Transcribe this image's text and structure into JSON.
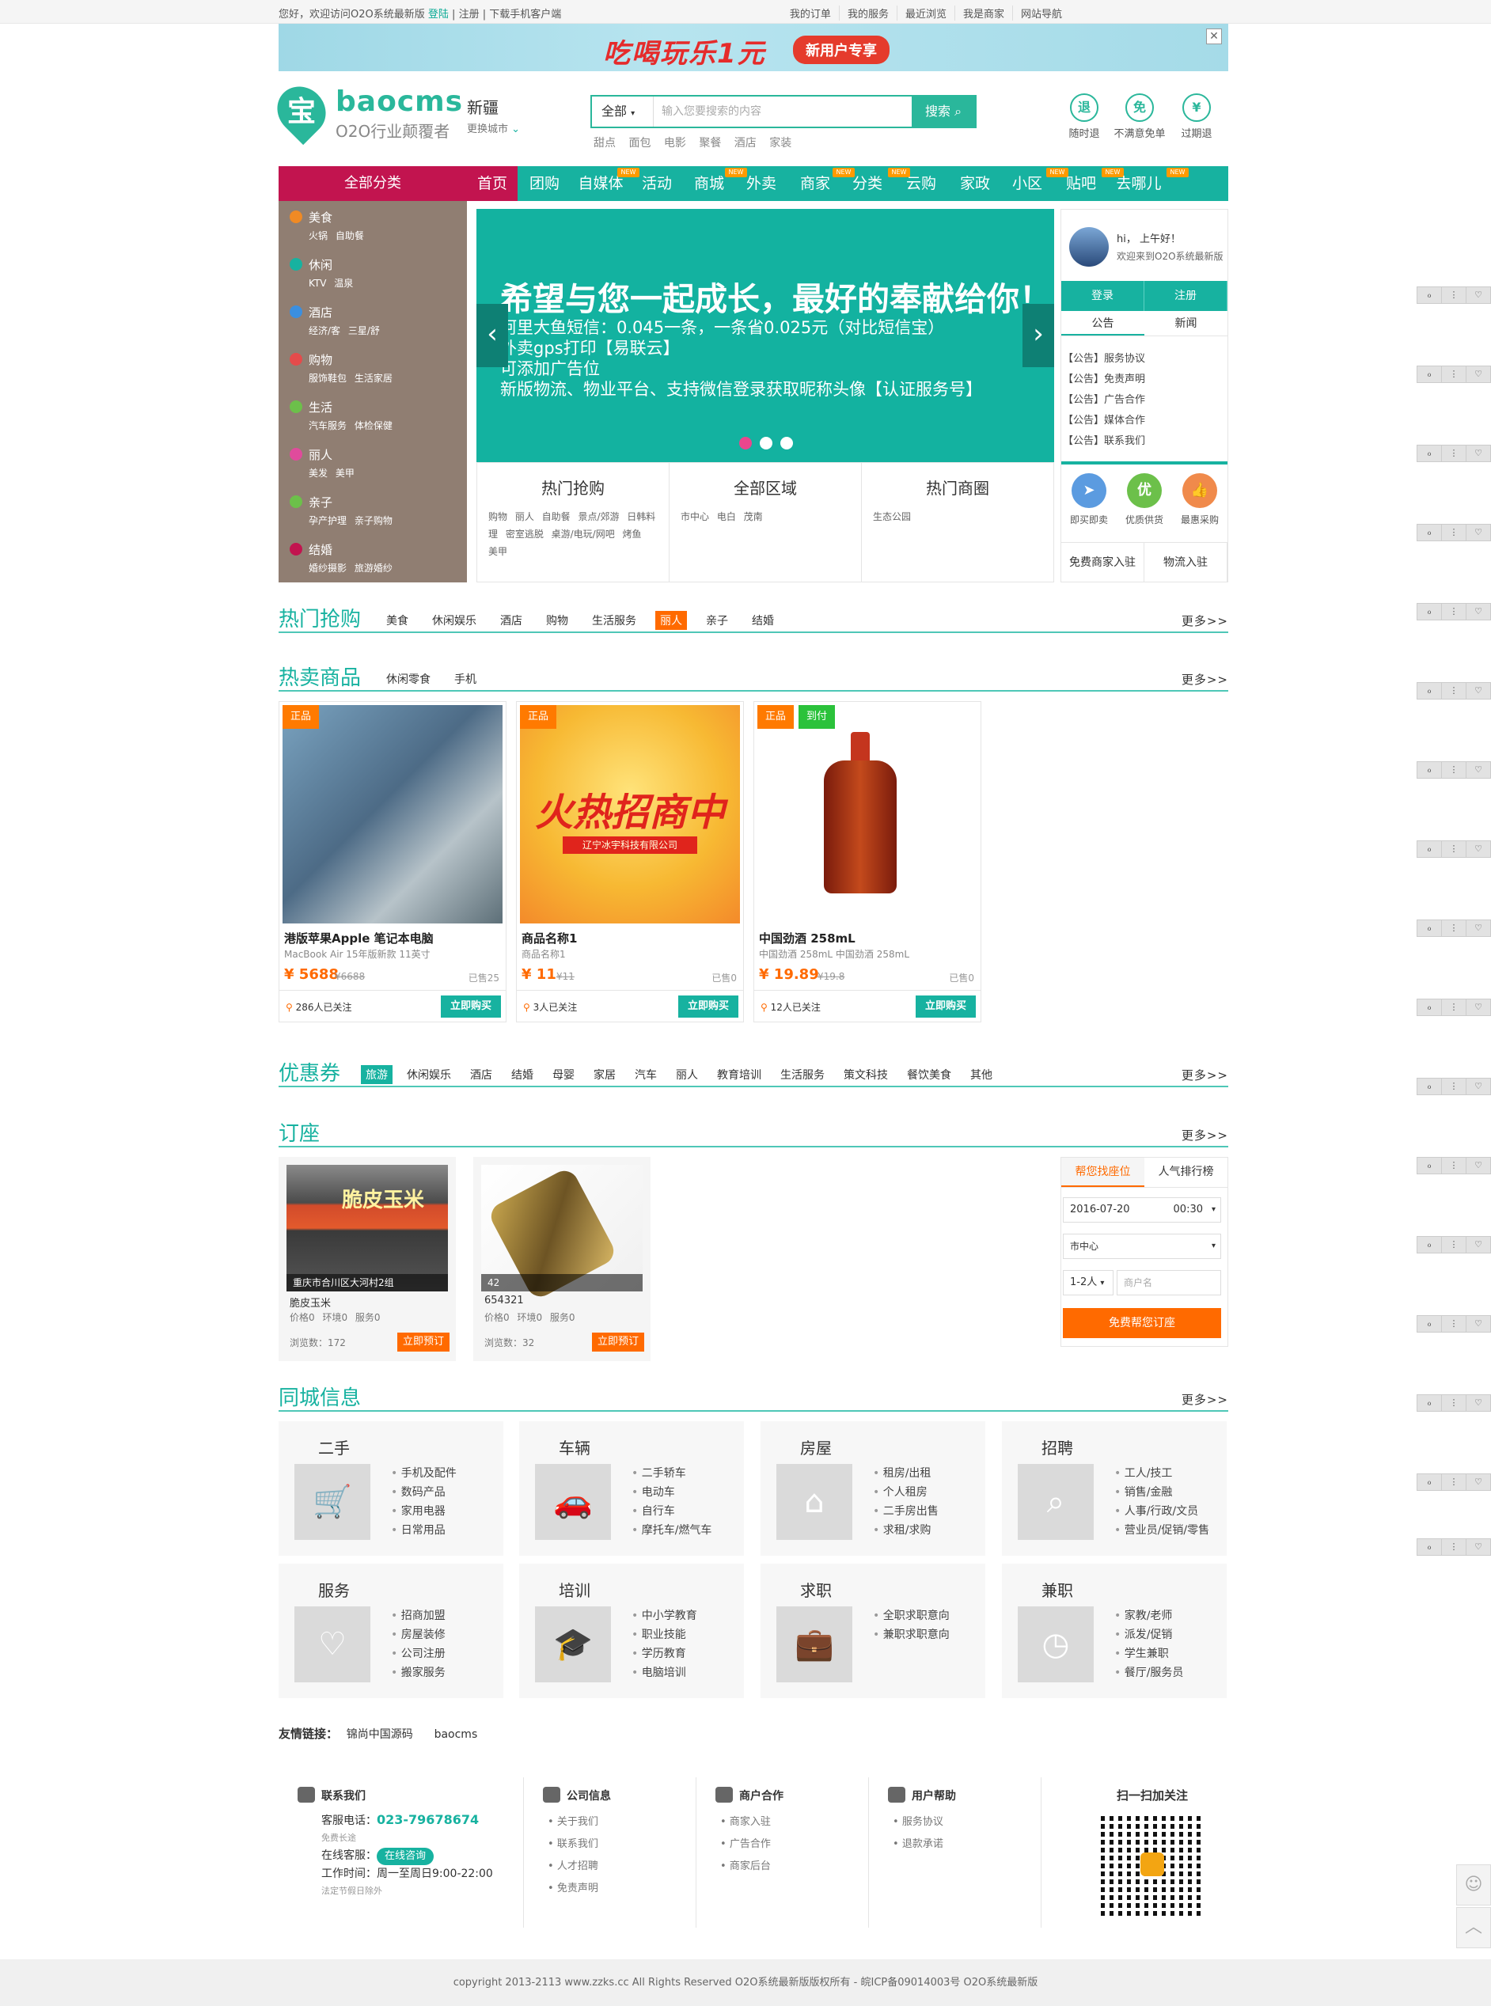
{
  "topbar": {
    "welcome": "您好，欢迎访问O2O系统最新版",
    "login": "登陆",
    "register": "注册",
    "download": "下载手机客户端",
    "right": [
      "我的订单",
      "我的服务",
      "最近浏览",
      "我是商家",
      "网站导航"
    ]
  },
  "banner": {
    "slogan": "吃喝玩乐1元",
    "tag": "新用户专享"
  },
  "logo": {
    "char": "宝",
    "name": "baocms",
    "sub": "O2O行业颠覆者"
  },
  "city": {
    "name": "新疆",
    "switch": "更换城市"
  },
  "search": {
    "category": "全部",
    "placeholder": "输入您要搜索的内容",
    "button": "搜索",
    "hot": "甜点 面包 电影 聚餐 酒店 家装"
  },
  "services": [
    {
      "icon": "退",
      "label": "随时退"
    },
    {
      "icon": "免",
      "label": "不满意免单"
    },
    {
      "icon": "¥",
      "label": "过期退"
    }
  ],
  "nav": {
    "all": "全部分类",
    "items": [
      "首页",
      "团购",
      "自媒体",
      "活动",
      "商城",
      "外卖",
      "商家",
      "分类",
      "云购",
      "家政",
      "小区",
      "贴吧",
      "去哪儿"
    ],
    "new_label": "NEW"
  },
  "side_cats": [
    {
      "name": "美食",
      "sub": "火锅 自助餐",
      "color": "#f08a24"
    },
    {
      "name": "休闲",
      "sub": "KTV 温泉",
      "color": "#17b2a0"
    },
    {
      "name": "酒店",
      "sub": "经济/客 三星/舒",
      "color": "#3b8fe0"
    },
    {
      "name": "购物",
      "sub": "服饰鞋包 生活家居",
      "color": "#e54b4b"
    },
    {
      "name": "生活",
      "sub": "汽车服务 体检保健",
      "color": "#6cc04a"
    },
    {
      "name": "丽人",
      "sub": "美发 美甲",
      "color": "#e04b9c"
    },
    {
      "name": "亲子",
      "sub": "孕产护理 亲子购物",
      "color": "#6cc04a"
    },
    {
      "name": "结婚",
      "sub": "婚纱摄影 旅游婚纱",
      "color": "#c2144f"
    }
  ],
  "slider": {
    "headline": "希望与您一起成长，最好的奉献给你！",
    "lines": [
      "阿里大鱼短信：0.045一条，一条省0.025元（对比短信宝）",
      "外卖gps打印【易联云】",
      "可添加广告位",
      "新版物流、物业平台、支持微信登录获取昵称头像【认证服务号】"
    ]
  },
  "region": [
    {
      "title": "热门抢购",
      "links": "购物 丽人 自助餐 景点/郊游 日韩料理 密室逃脱 桌游/电玩/网吧 烤鱼 美甲"
    },
    {
      "title": "全部区域",
      "links": "市中心 电白 茂南"
    },
    {
      "title": "热门商圈",
      "links": "生态公园"
    }
  ],
  "user": {
    "greet": "hi， 上午好！",
    "welcome": "欢迎来到O2O系统最新版",
    "login": "登录",
    "register": "注册",
    "tab_notice": "公告",
    "tab_news": "新闻",
    "notices": [
      "【公告】服务协议",
      "【公告】免责声明",
      "【公告】广告合作",
      "【公告】媒体合作",
      "【公告】联系我们"
    ],
    "quick": [
      {
        "label": "即买即卖",
        "color": "#5b9be0",
        "icon": "➤"
      },
      {
        "label": "优质供货",
        "color": "#6cc04a",
        "icon": "优"
      },
      {
        "label": "最惠采购",
        "color": "#f08a4b",
        "icon": "👍"
      }
    ],
    "join_merchant": "免费商家入驻",
    "join_logistics": "物流入驻"
  },
  "hot_buy": {
    "title": "热门抢购",
    "filters": [
      "美食",
      "休闲娱乐",
      "酒店",
      "购物",
      "生活服务",
      "丽人",
      "亲子",
      "结婚"
    ],
    "more": "更多>>"
  },
  "hot_sale": {
    "title": "热卖商品",
    "filters": [
      "休闲零食",
      "手机"
    ],
    "more": "更多>>",
    "products": [
      {
        "badge": "正品",
        "badge2": "",
        "name": "港版苹果Apple 笔记本电脑",
        "desc": "MacBook Air 15年版新款 11英寸",
        "price": "¥ 5688",
        "old": "¥6688",
        "sold": "已售25",
        "follow": "286人已关注",
        "buy": "立即购买"
      },
      {
        "badge": "正品",
        "badge2": "",
        "name": "商品名称1",
        "desc": "商品名称1",
        "price": "¥ 11",
        "old": "¥11",
        "sold": "已售0",
        "follow": "3人已关注",
        "buy": "立即购买",
        "img_text": "火热招商中",
        "img_sub": "辽宁冰宇科技有限公司"
      },
      {
        "badge": "正品",
        "badge2": "到付",
        "name": "中国劲酒 258mL",
        "desc": "中国劲酒 258mL 中国劲酒 258mL",
        "price": "¥ 19.89",
        "old": "¥19.8",
        "sold": "已售0",
        "follow": "12人已关注",
        "buy": "立即购买"
      }
    ]
  },
  "coupon": {
    "title": "优惠券",
    "filters": [
      "旅游",
      "休闲娱乐",
      "酒店",
      "结婚",
      "母婴",
      "家居",
      "汽车",
      "丽人",
      "教育培训",
      "生活服务",
      "策文科技",
      "餐饮美食",
      "其他"
    ],
    "more": "更多>>"
  },
  "booking": {
    "title": "订座",
    "more": "更多>>",
    "items": [
      {
        "caption": "重庆市合川区大河村2组",
        "name": "脆皮玉米",
        "stats": "价格0 环境0 服务0",
        "views": "浏览数：172",
        "btn": "立即预订",
        "sign": "脆皮玉米"
      },
      {
        "caption": "42",
        "name": "654321",
        "stats": "价格0 环境0 服务0",
        "views": "浏览数：32",
        "btn": "立即预订"
      }
    ],
    "tab_help": "帮您找座位",
    "tab_rank": "人气排行榜",
    "date": "2016-07-20",
    "time": "00:30",
    "area": "市中心",
    "people": "1-2人",
    "name_ph": "商户名",
    "submit": "免费帮您订座"
  },
  "city_info": {
    "title": "同城信息",
    "more": "更多>>",
    "cards": [
      {
        "title": "二手",
        "icon": "cart-icon",
        "glyph": "🛒",
        "items": [
          "手机及配件",
          "数码产品",
          "家用电器",
          "日常用品"
        ]
      },
      {
        "title": "车辆",
        "icon": "car-icon",
        "glyph": "🚗",
        "items": [
          "二手轿车",
          "电动车",
          "自行车",
          "摩托车/燃气车"
        ]
      },
      {
        "title": "房屋",
        "icon": "house-icon",
        "glyph": "⌂",
        "items": [
          "租房/出租",
          "个人租房",
          "二手房出售",
          "求租/求购"
        ]
      },
      {
        "title": "招聘",
        "icon": "search-person-icon",
        "glyph": "⌕",
        "items": [
          "工人/技工",
          "销售/金融",
          "人事/行政/文员",
          "营业员/促销/零售"
        ]
      },
      {
        "title": "服务",
        "icon": "heart-icon",
        "glyph": "♡",
        "items": [
          "招商加盟",
          "房屋装修",
          "公司注册",
          "搬家服务"
        ]
      },
      {
        "title": "培训",
        "icon": "graduation-icon",
        "glyph": "🎓",
        "items": [
          "中小学教育",
          "职业技能",
          "学历教育",
          "电脑培训"
        ]
      },
      {
        "title": "求职",
        "icon": "briefcase-icon",
        "glyph": "💼",
        "items": [
          "全职求职意向",
          "兼职求职意向"
        ]
      },
      {
        "title": "兼职",
        "icon": "clock-icon",
        "glyph": "◷",
        "items": [
          "家教/老师",
          "派发/促销",
          "学生兼职",
          "餐厅/服务员"
        ]
      }
    ]
  },
  "friend_links": {
    "label": "友情链接：",
    "links": [
      "锦尚中国源码",
      "baocms"
    ]
  },
  "footer": {
    "contact_title": "联系我们",
    "tel_label": "客服电话：",
    "tel": "023-79678674",
    "free": "免费长途",
    "online_label": "在线客服：",
    "online": "在线咨询",
    "hours": "工作时间：周一至周日9:00-22:00",
    "holiday": "法定节假日除外",
    "cols": [
      {
        "title": "公司信息",
        "items": [
          "关于我们",
          "联系我们",
          "人才招聘",
          "免责声明"
        ]
      },
      {
        "title": "商户合作",
        "items": [
          "商家入驻",
          "广告合作",
          "商家后台"
        ]
      },
      {
        "title": "用户帮助",
        "items": [
          "服务协议",
          "退款承诺"
        ]
      }
    ],
    "qr_title": "扫一扫加关注"
  },
  "copyright": "copyright 2013-2113 www.zzks.cc All Rights Reserved O2O系统最新版版权所有 - 皖ICP备09014003号 O2O系统最新版",
  "tool": {
    "a": "ℴ",
    "b": "⋮",
    "c": "♡"
  }
}
